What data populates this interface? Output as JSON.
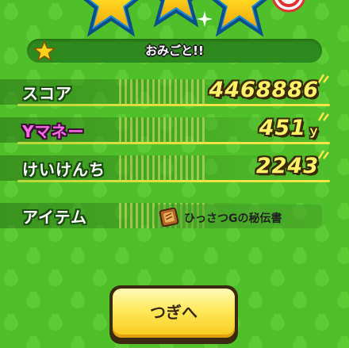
{
  "header": {
    "banner_text": "おみごと!!",
    "stars_earned": 3
  },
  "results": [
    {
      "label": "スコア",
      "value": "4468886",
      "unit": ""
    },
    {
      "label": "Yマネー",
      "value": "451",
      "unit": "ｙ"
    },
    {
      "label": "けいけんち",
      "value": "2243",
      "unit": ""
    }
  ],
  "item": {
    "label": "アイテム",
    "name": "ひっさつGの秘伝書",
    "icon": "scroll-book-icon"
  },
  "next_button": {
    "label": "つぎへ"
  },
  "colors": {
    "background": "#4fbf2a",
    "value_yellow": "#fff36a",
    "money_pink": "#ff6ae6",
    "button_yellow": "#ffe95a"
  }
}
